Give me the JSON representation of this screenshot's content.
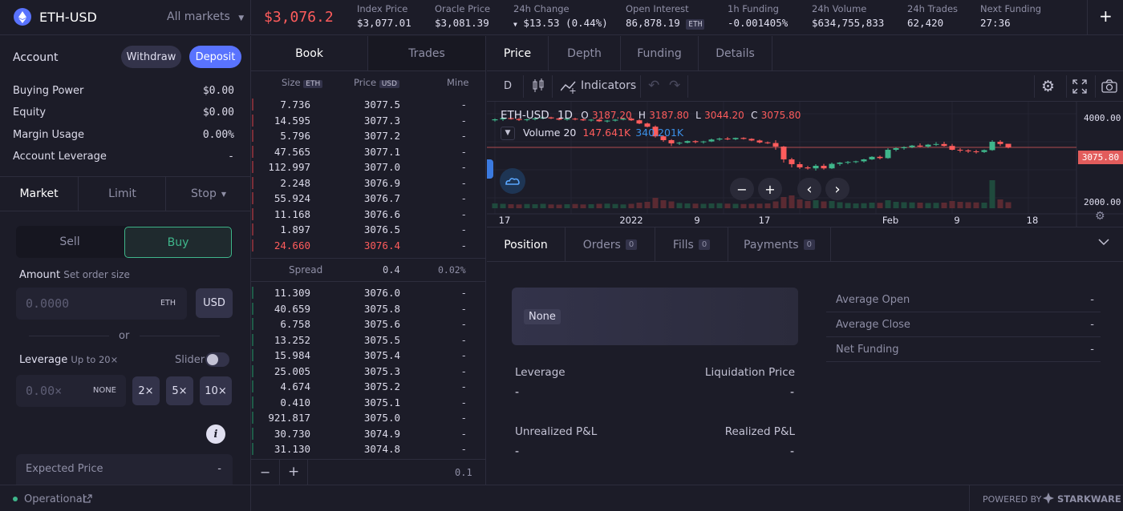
{
  "header": {
    "market": "ETH-USD",
    "all_markets": "All markets",
    "price": "$3,076.2",
    "stats": [
      {
        "label": "Index Price",
        "value": "$3,077.01"
      },
      {
        "label": "Oracle Price",
        "value": "$3,081.39"
      },
      {
        "label": "24h Change",
        "value": "$13.53 (0.44%)"
      },
      {
        "label": "Open Interest",
        "value": "86,878.19",
        "badge": "ETH"
      },
      {
        "label": "1h Funding",
        "value": "-0.001405%"
      },
      {
        "label": "24h Volume",
        "value": "$634,755,833"
      },
      {
        "label": "24h Trades",
        "value": "62,420"
      },
      {
        "label": "Next Funding",
        "value": "27:36"
      }
    ],
    "add": "+"
  },
  "account": {
    "title": "Account",
    "withdraw": "Withdraw",
    "deposit": "Deposit",
    "rows": [
      {
        "label": "Buying Power",
        "value": "$0.00"
      },
      {
        "label": "Equity",
        "value": "$0.00"
      },
      {
        "label": "Margin Usage",
        "value": "0.00%"
      },
      {
        "label": "Account Leverage",
        "value": "-"
      }
    ]
  },
  "order": {
    "tabs": [
      "Market",
      "Limit",
      "Stop"
    ],
    "sell": "Sell",
    "buy": "Buy",
    "amount_label": "Amount",
    "amount_hint": "Set order size",
    "amount_placeholder": "0.0000",
    "amount_unit": "ETH",
    "usd": "USD",
    "or": "or",
    "leverage_label": "Leverage",
    "leverage_hint": "Up to 20×",
    "slider": "Slider",
    "leverage_placeholder": "0.00×",
    "none": "NONE",
    "lev_buttons": [
      "2×",
      "5×",
      "10×"
    ],
    "info": "i",
    "expected_price": "Expected Price",
    "expected_value": "-"
  },
  "book": {
    "tabs": [
      "Book",
      "Trades"
    ],
    "headers": {
      "size": "Size",
      "size_unit": "ETH",
      "price": "Price",
      "price_unit": "USD",
      "mine": "Mine"
    },
    "asks": [
      {
        "size": "7.736",
        "price": "3077.5",
        "mine": "-",
        "depth": 0.01
      },
      {
        "size": "14.595",
        "price": "3077.3",
        "mine": "-",
        "depth": 0.01
      },
      {
        "size": "5.796",
        "price": "3077.2",
        "mine": "-",
        "depth": 0.01
      },
      {
        "size": "47.565",
        "price": "3077.1",
        "mine": "-",
        "depth": 0.01
      },
      {
        "size": "112.997",
        "price": "3077.0",
        "mine": "-",
        "depth": 0.01
      },
      {
        "size": "2.248",
        "price": "3076.9",
        "mine": "-",
        "depth": 0.01
      },
      {
        "size": "55.924",
        "price": "3076.7",
        "mine": "-",
        "depth": 0.01
      },
      {
        "size": "11.168",
        "price": "3076.6",
        "mine": "-",
        "depth": 0.01
      },
      {
        "size": "1.897",
        "price": "3076.5",
        "mine": "-",
        "depth": 0.01
      },
      {
        "size": "24.660",
        "price": "3076.4",
        "mine": "-",
        "depth": 0.01
      }
    ],
    "spread": {
      "label": "Spread",
      "value": "0.4",
      "percent": "0.02%"
    },
    "bids": [
      {
        "size": "11.309",
        "price": "3076.0",
        "mine": "-"
      },
      {
        "size": "40.659",
        "price": "3075.8",
        "mine": "-"
      },
      {
        "size": "6.758",
        "price": "3075.6",
        "mine": "-"
      },
      {
        "size": "13.252",
        "price": "3075.5",
        "mine": "-"
      },
      {
        "size": "15.984",
        "price": "3075.4",
        "mine": "-"
      },
      {
        "size": "25.005",
        "price": "3075.3",
        "mine": "-"
      },
      {
        "size": "4.674",
        "price": "3075.2",
        "mine": "-"
      },
      {
        "size": "0.410",
        "price": "3075.1",
        "mine": "-"
      },
      {
        "size": "921.817",
        "price": "3075.0",
        "mine": "-"
      },
      {
        "size": "30.730",
        "price": "3074.9",
        "mine": "-"
      },
      {
        "size": "31.130",
        "price": "3074.8",
        "mine": "-"
      }
    ],
    "footer": {
      "minus": "−",
      "plus": "+",
      "step": "0.1"
    }
  },
  "chart": {
    "tabs": [
      "Price",
      "Depth",
      "Funding",
      "Details"
    ],
    "interval": "D",
    "indicators": "Indicators",
    "symbol": "ETH-USD",
    "tf": "1D",
    "ohlc": {
      "o_label": "O",
      "o": "3187.20",
      "h_label": "H",
      "h": "3187.80",
      "l_label": "L",
      "l": "3044.20",
      "c_label": "C",
      "c": "3075.80"
    },
    "volume_label": "Volume 20",
    "vol1": "147.641K",
    "vol2": "340.201K",
    "y_ticks": [
      "4000.00",
      "2000.00"
    ],
    "last_price": "3075.80",
    "x_ticks": [
      "17",
      "2022",
      "9",
      "17",
      "Feb",
      "9",
      "18"
    ],
    "minus": "−",
    "plus": "+",
    "prev": "‹",
    "next": "›"
  },
  "chart_data": {
    "type": "candlestick",
    "ylim": [
      2000,
      4000
    ],
    "candles": [
      [
        3920,
        3980,
        3880,
        3950
      ],
      [
        3950,
        4020,
        3900,
        3990
      ],
      [
        3990,
        4010,
        3940,
        3960
      ],
      [
        3960,
        3990,
        3900,
        3930
      ],
      [
        3930,
        3970,
        3890,
        3950
      ],
      [
        3950,
        4000,
        3920,
        3980
      ],
      [
        3980,
        4040,
        3950,
        4010
      ],
      [
        4010,
        4030,
        3960,
        3980
      ],
      [
        3980,
        4000,
        3920,
        3940
      ],
      [
        3940,
        3990,
        3910,
        3970
      ],
      [
        3970,
        4000,
        3920,
        3950
      ],
      [
        3950,
        3980,
        3900,
        3920
      ],
      [
        3920,
        3960,
        3880,
        3940
      ],
      [
        3940,
        3970,
        3870,
        3890
      ],
      [
        3890,
        3930,
        3850,
        3910
      ],
      [
        3910,
        3960,
        3880,
        3940
      ],
      [
        3940,
        3990,
        3920,
        3970
      ],
      [
        3970,
        4010,
        3900,
        3920
      ],
      [
        3920,
        3950,
        3800,
        3820
      ],
      [
        3820,
        3850,
        3700,
        3720
      ],
      [
        3720,
        3760,
        3380,
        3420
      ],
      [
        3420,
        3450,
        3250,
        3300
      ],
      [
        3300,
        3330,
        3120,
        3200
      ],
      [
        3200,
        3250,
        3150,
        3220
      ],
      [
        3220,
        3290,
        3200,
        3270
      ],
      [
        3270,
        3300,
        3200,
        3240
      ],
      [
        3240,
        3280,
        3190,
        3260
      ],
      [
        3260,
        3350,
        3240,
        3320
      ],
      [
        3320,
        3380,
        3280,
        3350
      ],
      [
        3350,
        3400,
        3300,
        3330
      ],
      [
        3330,
        3380,
        3300,
        3370
      ],
      [
        3370,
        3390,
        3320,
        3340
      ],
      [
        3340,
        3360,
        3270,
        3290
      ],
      [
        3290,
        3320,
        3200,
        3230
      ],
      [
        3230,
        3260,
        3180,
        3210
      ],
      [
        3210,
        3300,
        3000,
        3100
      ],
      [
        3100,
        3120,
        2600,
        2700
      ],
      [
        2700,
        2750,
        2450,
        2550
      ],
      [
        2550,
        2620,
        2400,
        2450
      ],
      [
        2450,
        2500,
        2380,
        2420
      ],
      [
        2420,
        2550,
        2350,
        2500
      ],
      [
        2500,
        2560,
        2380,
        2420
      ],
      [
        2420,
        2600,
        2400,
        2560
      ],
      [
        2560,
        2620,
        2500,
        2600
      ],
      [
        2600,
        2650,
        2550,
        2620
      ],
      [
        2620,
        2660,
        2580,
        2640
      ],
      [
        2640,
        2720,
        2600,
        2700
      ],
      [
        2700,
        2800,
        2680,
        2780
      ],
      [
        2780,
        2820,
        2700,
        2740
      ],
      [
        2740,
        3050,
        2720,
        3000
      ],
      [
        3000,
        3080,
        2950,
        3050
      ],
      [
        3050,
        3110,
        3000,
        3080
      ],
      [
        3080,
        3150,
        3050,
        3130
      ],
      [
        3130,
        3200,
        3080,
        3100
      ],
      [
        3100,
        3180,
        3060,
        3160
      ],
      [
        3160,
        3240,
        3120,
        3180
      ],
      [
        3180,
        3250,
        3100,
        3120
      ],
      [
        3120,
        3180,
        2980,
        3000
      ],
      [
        3000,
        3050,
        2920,
        2980
      ],
      [
        2980,
        3020,
        2900,
        2950
      ],
      [
        2950,
        3000,
        2880,
        2930
      ],
      [
        2930,
        3010,
        2900,
        2990
      ],
      [
        2990,
        3300,
        2970,
        3250
      ],
      [
        3250,
        3300,
        3120,
        3180
      ],
      [
        3187.2,
        3187.8,
        3044.2,
        3075.8
      ]
    ],
    "volumes": [
      120,
      110,
      100,
      95,
      105,
      100,
      110,
      95,
      90,
      100,
      105,
      95,
      100,
      110,
      115,
      105,
      95,
      110,
      140,
      160,
      260,
      200,
      170,
      130,
      120,
      115,
      110,
      120,
      125,
      115,
      110,
      105,
      110,
      115,
      120,
      170,
      280,
      320,
      220,
      180,
      200,
      170,
      180,
      150,
      130,
      120,
      125,
      140,
      135,
      200,
      160,
      150,
      145,
      140,
      130,
      135,
      140,
      180,
      160,
      150,
      145,
      140,
      700,
      220,
      150
    ]
  },
  "positions": {
    "tabs": [
      {
        "label": "Position"
      },
      {
        "label": "Orders",
        "count": "0"
      },
      {
        "label": "Fills",
        "count": "0"
      },
      {
        "label": "Payments",
        "count": "0"
      }
    ],
    "none": "None",
    "leverage": "Leverage",
    "leverage_val": "-",
    "liq": "Liquidation Price",
    "liq_val": "-",
    "upnl": "Unrealized P&L",
    "upnl_val": "-",
    "rpnl": "Realized P&L",
    "rpnl_val": "-",
    "side_rows": [
      {
        "label": "Average Open",
        "value": "-"
      },
      {
        "label": "Average Close",
        "value": "-"
      },
      {
        "label": "Net Funding",
        "value": "-"
      }
    ]
  },
  "footer": {
    "status": "Operational",
    "powered": "POWERED BY",
    "brand": "STARKWARE"
  },
  "colors": {
    "accent": "#5973fe",
    "red": "#ff5c5c",
    "green": "#3fb68b",
    "bg": "#1c1c28"
  }
}
